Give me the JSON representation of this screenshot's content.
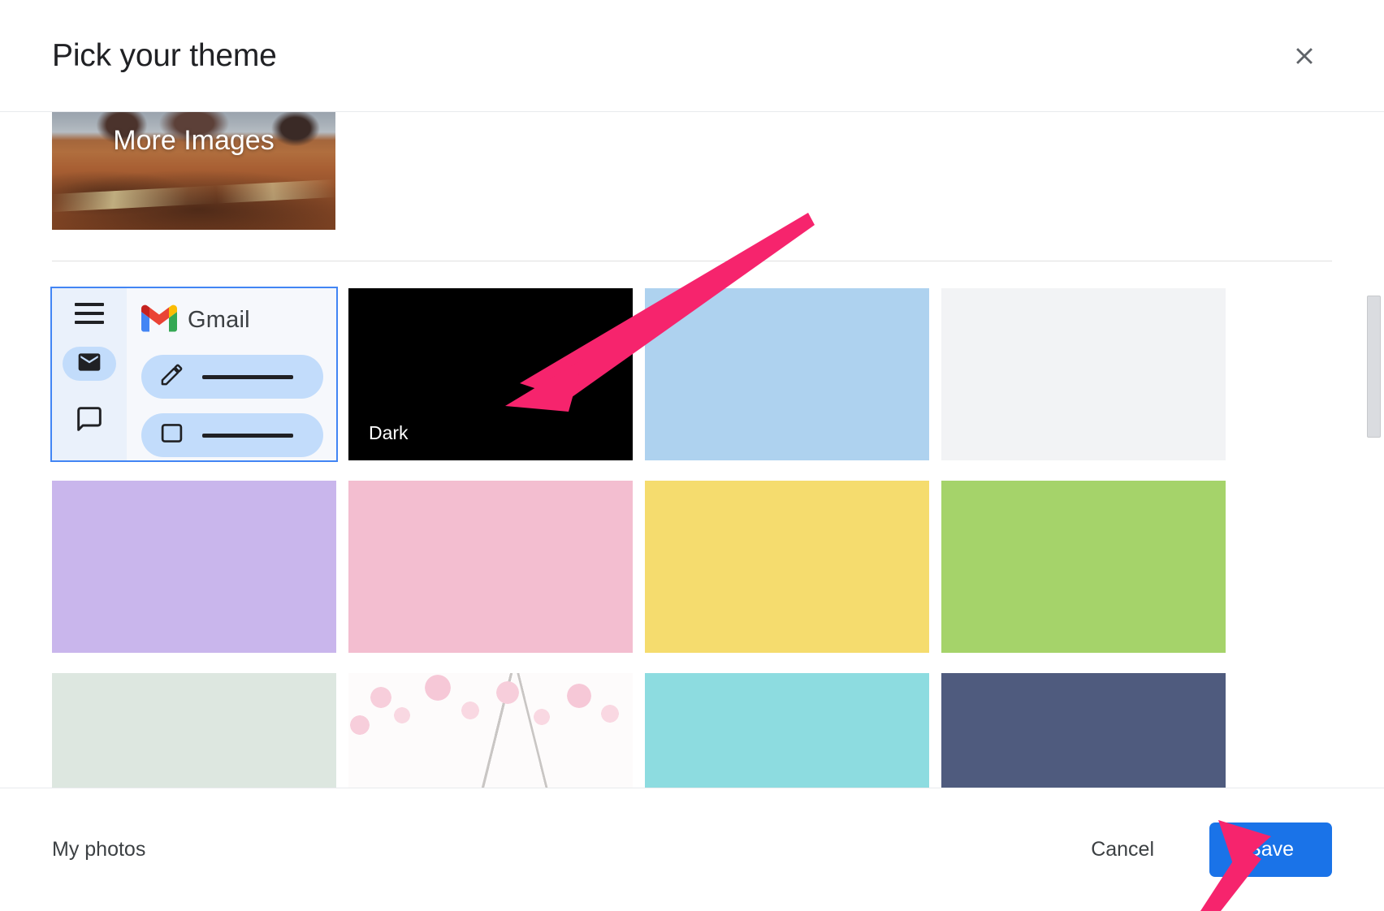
{
  "dialog": {
    "title": "Pick your theme",
    "close_icon": "close-icon"
  },
  "more_images": {
    "label": "More Images",
    "description": "desert mesa landscape photo thumbnail"
  },
  "preview_tile": {
    "brand_label": "Gmail",
    "menu_icon": "hamburger-menu-icon",
    "mail_icon": "mail-icon",
    "chat_icon": "chat-bubble-icon",
    "compose_icon": "pencil-compose-icon",
    "inbox_icon": "inbox-icon",
    "selected": true
  },
  "themes": [
    {
      "name": "Default light",
      "label": "",
      "color": "#f6f8fc",
      "kind": "gmail-preview",
      "selected": true
    },
    {
      "name": "Dark",
      "label": "Dark",
      "color": "#000000",
      "kind": "solid",
      "selected": false
    },
    {
      "name": "Light blue",
      "label": "",
      "color": "#aed2ef",
      "kind": "solid",
      "selected": false
    },
    {
      "name": "Off white",
      "label": "",
      "color": "#f2f3f5",
      "kind": "solid",
      "selected": false
    },
    {
      "name": "Lavender",
      "label": "",
      "color": "#c9b6ec",
      "kind": "solid",
      "selected": false
    },
    {
      "name": "Pink",
      "label": "",
      "color": "#f3bed0",
      "kind": "solid",
      "selected": false
    },
    {
      "name": "Yellow",
      "label": "",
      "color": "#f5dc6e",
      "kind": "solid",
      "selected": false
    },
    {
      "name": "Green",
      "label": "",
      "color": "#a5d36a",
      "kind": "solid",
      "selected": false
    },
    {
      "name": "Mint",
      "label": "",
      "color": "#dde7e0",
      "kind": "solid",
      "selected": false
    },
    {
      "name": "Cherry blossom",
      "label": "",
      "color": "#fdfbfb",
      "kind": "blossom",
      "selected": false
    },
    {
      "name": "Turquoise",
      "label": "",
      "color": "#8ddce0",
      "kind": "solid",
      "selected": false
    },
    {
      "name": "Slate blue",
      "label": "",
      "color": "#4f5b7e",
      "kind": "solid",
      "selected": false
    }
  ],
  "footer": {
    "my_photos": "My photos",
    "cancel": "Cancel",
    "save": "Save"
  },
  "colors": {
    "accent_blue": "#1a73e8",
    "selection_blue": "#4285f4",
    "annotation_pink": "#f6246d"
  },
  "annotations": [
    {
      "name": "arrow-to-dark-theme",
      "color": "#f6246d",
      "points_at": "Dark theme tile"
    },
    {
      "name": "arrow-to-save-button",
      "color": "#f6246d",
      "points_at": "Save button"
    }
  ]
}
